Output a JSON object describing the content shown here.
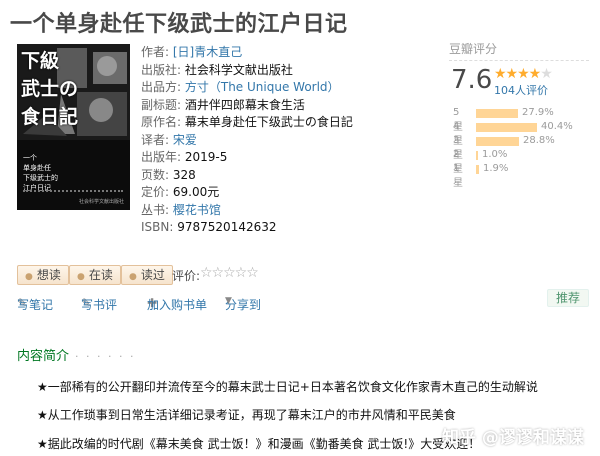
{
  "title": "一个单身赴任下级武士的江户日记",
  "cover": {
    "big_lines": [
      "下級",
      "武士の",
      "食日記"
    ],
    "small_lines": [
      "一个",
      "单身赴任",
      "下级武士的"
    ],
    "small_line4": "江户日记",
    "publisher_mark": "社会科学文献出版社"
  },
  "info": {
    "author_label": "作者:",
    "author": "[日]青木直己",
    "publisher_label": "出版社:",
    "publisher": "社会科学文献出版社",
    "producer_label": "出品方:",
    "producer": "方寸（The Unique World）",
    "subtitle_label": "副标题:",
    "subtitle": "酒井伴四郎幕末食生活",
    "original_label": "原作名:",
    "original": "幕末单身赴任下级武士の食日記",
    "translator_label": "译者:",
    "translator": "宋爱",
    "date_label": "出版年:",
    "date": "2019-5",
    "pages_label": "页数:",
    "pages": "328",
    "price_label": "定价:",
    "price": "69.00元",
    "series_label": "丛书:",
    "series": "樱花书馆",
    "isbn_label": "ISBN:",
    "isbn": "9787520142632"
  },
  "rating": {
    "header": "豆瓣评分",
    "score": "7.6",
    "stars_value": 4,
    "count": "104人评价",
    "breakdown": [
      {
        "label": "5星",
        "percent": 27.9,
        "text": "27.9%"
      },
      {
        "label": "4星",
        "percent": 40.4,
        "text": "40.4%"
      },
      {
        "label": "3星",
        "percent": 28.8,
        "text": "28.8%"
      },
      {
        "label": "2星",
        "percent": 1.0,
        "text": "1.0%"
      },
      {
        "label": "1星",
        "percent": 1.9,
        "text": "1.9%"
      }
    ]
  },
  "actions": {
    "want": "想读",
    "reading": "在读",
    "read": "读过",
    "rate_label": "评价:",
    "rate_stars": "☆☆☆☆☆"
  },
  "tools": {
    "note": "写笔记",
    "review": "写书评",
    "cart": "加入购书单",
    "share": "分享到"
  },
  "recommend": "推荐",
  "section": {
    "title": "内容简介",
    "dots": "· · · · · ·"
  },
  "intro": [
    "★一部稀有的公开翻印并流传至今的幕末武士日记+日本著名饮食文化作家青木直己的生动解说",
    "★从工作琐事到日常生活详细记录考证，再现了幕末江户的市井风情和平民美食",
    "★据此改编的时代剧《幕末美食 武士饭！》和漫画《勤番美食 武士饭!》大受欢迎！"
  ],
  "watermark": "知乎 @谬谬和谋谋",
  "colors": {
    "link": "#3377aa",
    "green": "#007722",
    "star": "#ffac2d",
    "bar": "#ffd596"
  }
}
